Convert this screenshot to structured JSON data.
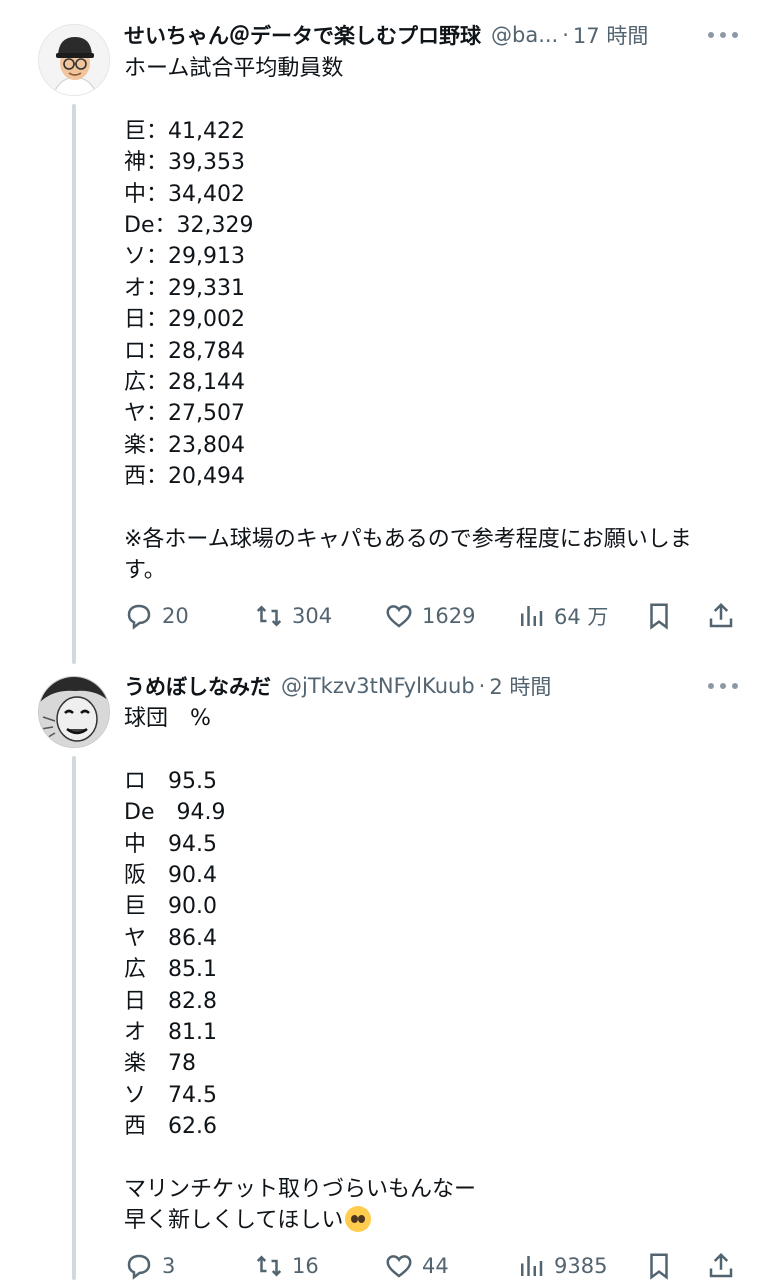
{
  "tweet1": {
    "display_name": "せいちゃん＠データで楽しむプロ野球",
    "handle": "@ba...",
    "separator": "·",
    "time": "17 時間",
    "lines": [
      "ホーム試合平均動員数",
      "",
      "巨：41,422",
      "神：39,353",
      "中：34,402",
      "De：32,329",
      "ソ：29,913",
      "オ：29,331",
      "日：29,002",
      "ロ：28,784",
      "広：28,144",
      "ヤ：27,507",
      "楽：23,804",
      "西：20,494",
      "",
      "※各ホーム球場のキャパもあるので参考程度にお願いしま",
      "す。"
    ],
    "stats": {
      "replies": "20",
      "retweets": "304",
      "likes": "1629",
      "views": "64 万"
    }
  },
  "tweet2": {
    "display_name": "うめぼしなみだ",
    "handle": "@jTkzv3tNFylKuub",
    "separator": "·",
    "time": "2 時間",
    "lines": [
      "球団　%",
      "",
      "ロ　95.5",
      "De　94.9",
      "中　94.5",
      "阪　90.4",
      "巨　90.0",
      "ヤ　86.4",
      "広　85.1",
      "日　82.8",
      "オ　81.1",
      "楽　78",
      "ソ　74.5",
      "西　62.6",
      "",
      "マリンチケット取りづらいもんなー"
    ],
    "last_line": "早く新しくしてほしい",
    "last_line_emoji": "pleading-face-emoji",
    "stats": {
      "replies": "3",
      "retweets": "16",
      "likes": "44",
      "views": "9385"
    }
  },
  "icons": [
    "reply-icon",
    "retweet-icon",
    "like-icon",
    "views-icon",
    "bookmark-icon",
    "share-icon",
    "more-icon"
  ],
  "colors": {
    "text": "#0f1419",
    "secondary": "#536471",
    "thread_line": "#cfd9de"
  }
}
